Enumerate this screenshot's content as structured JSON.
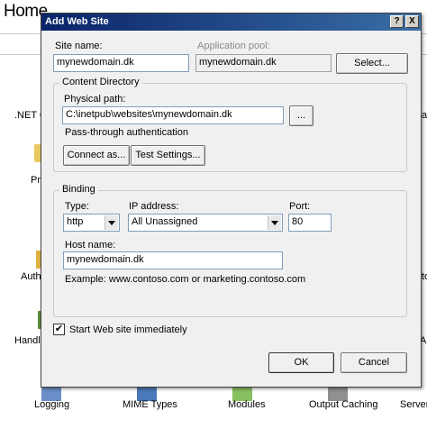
{
  "background": {
    "home_title": "Home",
    "left_labels": [
      ".NET G",
      "Pr",
      "Auth",
      "Handle"
    ],
    "right_labels": [
      "a",
      "to",
      "AF"
    ],
    "bottom_labels": [
      "Logging",
      "MIME Types",
      "Modules",
      "Output Caching",
      "Server"
    ]
  },
  "dialog": {
    "title": "Add Web Site",
    "help_button": "?",
    "close_button": "X",
    "site_name_label": "Site name:",
    "site_name_value": "mynewdomain.dk",
    "app_pool_label": "Application pool:",
    "app_pool_value": "mynewdomain.dk",
    "select_button": "Select...",
    "content_directory": {
      "legend": "Content Directory",
      "physical_path_label": "Physical path:",
      "physical_path_value": "C:\\inetpub\\websites\\mynewdomain.dk",
      "browse_button": "...",
      "auth_text": "Pass-through authentication",
      "connect_as_button": "Connect as...",
      "test_settings_button": "Test Settings..."
    },
    "binding": {
      "legend": "Binding",
      "type_label": "Type:",
      "type_value": "http",
      "ip_label": "IP address:",
      "ip_value": "All Unassigned",
      "port_label": "Port:",
      "port_value": "80",
      "host_label": "Host name:",
      "host_value": "mynewdomain.dk",
      "example_text": "Example: www.contoso.com or marketing.contoso.com"
    },
    "start_checkbox_checked": true,
    "start_checkbox_mark": "✔",
    "start_label": "Start Web site immediately",
    "ok_button": "OK",
    "cancel_button": "Cancel"
  }
}
